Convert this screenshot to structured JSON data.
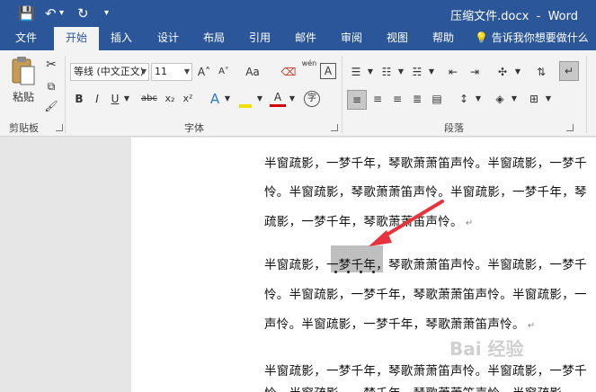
{
  "window": {
    "title": "压缩文件.docx  -  Word",
    "save_icon": "💾",
    "undo_icon": "↶",
    "redo_icon": "↻",
    "qa_dropdown": "▾"
  },
  "tabs": [
    "文件",
    "开始",
    "插入",
    "设计",
    "布局",
    "引用",
    "邮件",
    "审阅",
    "视图",
    "帮助"
  ],
  "active_tab": "开始",
  "tell_me": "告诉我你想要做什么",
  "clipboard": {
    "paste_label": "粘贴",
    "group_label": "剪贴板"
  },
  "font": {
    "name": "等线 (中文正文)",
    "size": "11",
    "group_label": "字体",
    "grow": "A˄",
    "shrink": "A˅",
    "case": "Aa",
    "bold": "B",
    "italic": "I",
    "underline": "U",
    "strike": "abc",
    "subscript": "x₂",
    "superscript": "x²",
    "phonetic": "wén",
    "border_char": "A",
    "effects": "A",
    "font_color": "A",
    "circle_char": "字"
  },
  "paragraph": {
    "group_label": "段落"
  },
  "document": {
    "lines": [
      "半窗疏影，一梦千年，琴歌萧萧笛声怜。半窗疏影，一梦千",
      "怜。半窗疏影，琴歌萧萧笛声怜。半窗疏影，一梦千年，琴",
      "疏影，一梦千年，琴歌萧萧笛声怜。",
      "半窗疏影，一梦千年，琴歌萧萧笛声怜。半窗疏影，一梦千",
      "怜。半窗疏影，一梦千年，琴歌萧萧笛声怜。半窗疏影，一",
      "声怜。半窗疏影，一梦千年，琴歌萧萧笛声怜。",
      "半窗疏影，一梦千年，琴歌萧萧笛声怜。半窗疏影，一梦千",
      "怜。半窗疏影，一梦千年，琴歌萧萧笛声怜。半窗疏影，一"
    ],
    "paragraph_mark": "↵"
  },
  "watermark": "Bai 经验"
}
